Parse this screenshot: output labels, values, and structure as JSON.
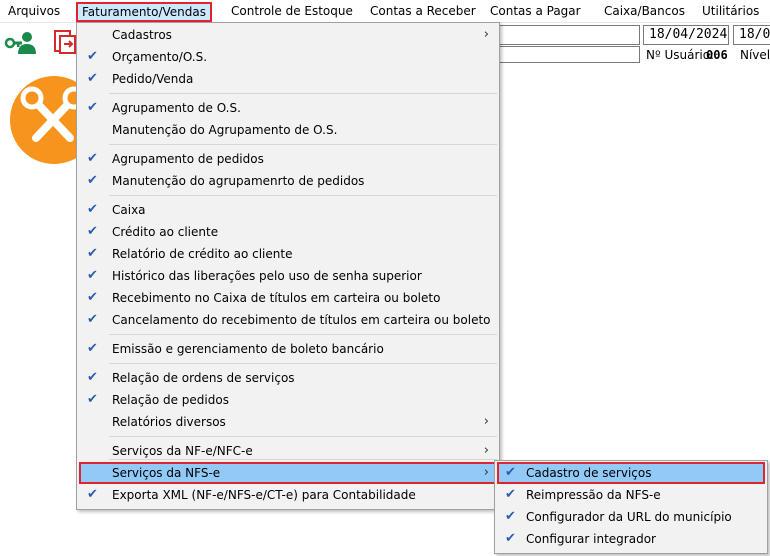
{
  "menubar": {
    "items": [
      "Arquivos",
      "Faturamento/Vendas",
      "Controle de Estoque",
      "Contas a Receber",
      "Contas a Pagar",
      "Caixa/Bancos",
      "Utilitários"
    ]
  },
  "header": {
    "date1": "18/04/2024",
    "date2": "18/0",
    "usuario_label": "Nº Usuário:",
    "usuario_value": "006",
    "nivel_label": "Nível:"
  },
  "menu": {
    "items": [
      {
        "label": "Cadastros",
        "checked": false,
        "arrow": true
      },
      {
        "label": "Orçamento/O.S.",
        "checked": true
      },
      {
        "label": "Pedido/Venda",
        "checked": true
      },
      {
        "label": "Agrupamento de O.S.",
        "checked": true
      },
      {
        "label": "Manutenção do Agrupamento de O.S.",
        "checked": false
      },
      {
        "label": "Agrupamento de pedidos",
        "checked": true
      },
      {
        "label": "Manutenção do agrupamenrto de pedidos",
        "checked": true
      },
      {
        "label": "Caixa",
        "checked": true
      },
      {
        "label": "Crédito ao cliente",
        "checked": true
      },
      {
        "label": "Relatório de crédito ao cliente",
        "checked": true
      },
      {
        "label": "Histórico das liberações pelo uso de senha superior",
        "checked": true
      },
      {
        "label": "Recebimento no Caixa de títulos em carteira ou boleto",
        "checked": true
      },
      {
        "label": "Cancelamento do recebimento de títulos em carteira ou boleto",
        "checked": true
      },
      {
        "label": "Emissão e gerenciamento de boleto bancário",
        "checked": true
      },
      {
        "label": "Relação de ordens de serviços",
        "checked": true
      },
      {
        "label": "Relação de pedidos",
        "checked": true
      },
      {
        "label": "Relatórios diversos",
        "checked": false,
        "arrow": true
      },
      {
        "label": "Serviços da NF-e/NFC-e",
        "checked": false,
        "arrow": true
      },
      {
        "label": "Serviços da NFS-e",
        "checked": false,
        "arrow": true,
        "highlighted": true
      },
      {
        "label": "Exporta XML (NF-e/NFS-e/CT-e) para Contabilidade",
        "checked": true
      }
    ]
  },
  "submenu": {
    "items": [
      {
        "label": "Cadastro de serviços",
        "checked": true,
        "highlighted": true
      },
      {
        "label": "Reimpressão da NFS-e",
        "checked": true
      },
      {
        "label": "Configurador da URL do município",
        "checked": true
      },
      {
        "label": "Configurar integrador",
        "checked": true
      }
    ]
  },
  "icons": {
    "check": "✔",
    "arrow": "›"
  }
}
